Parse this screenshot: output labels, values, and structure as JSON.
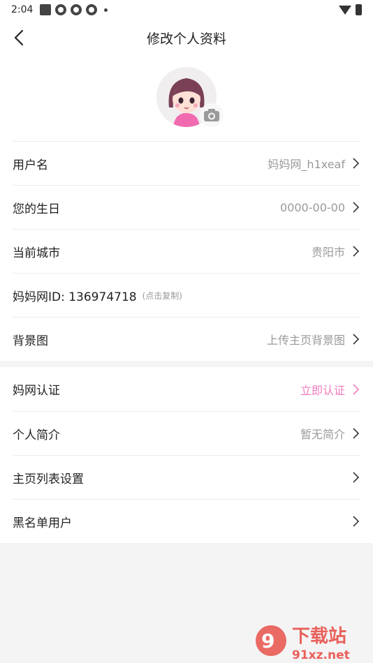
{
  "status": {
    "time": "2:04"
  },
  "header": {
    "title": "修改个人资料"
  },
  "profile": {
    "rows1": [
      {
        "label": "用户名",
        "value": "妈妈网_h1xeaf"
      },
      {
        "label": "您的生日",
        "value": "0000-00-00"
      },
      {
        "label": "当前城市",
        "value": "贵阳市"
      }
    ],
    "id_row": {
      "label": "妈妈网ID: 136974718",
      "hint": "(点击复制)"
    },
    "bg_row": {
      "label": "背景图",
      "value": "上传主页背景图"
    },
    "rows2": [
      {
        "label": "妈网认证",
        "value": "立即认证"
      },
      {
        "label": "个人简介",
        "value": "暂无简介"
      },
      {
        "label": "主页列表设置",
        "value": ""
      },
      {
        "label": "黑名单用户",
        "value": ""
      }
    ]
  },
  "watermark": {
    "text": "下载站",
    "sub": "91xz.net"
  },
  "colors": {
    "accent": "#f07cc0",
    "muted": "#999999",
    "bg": "#f4f4f5"
  }
}
